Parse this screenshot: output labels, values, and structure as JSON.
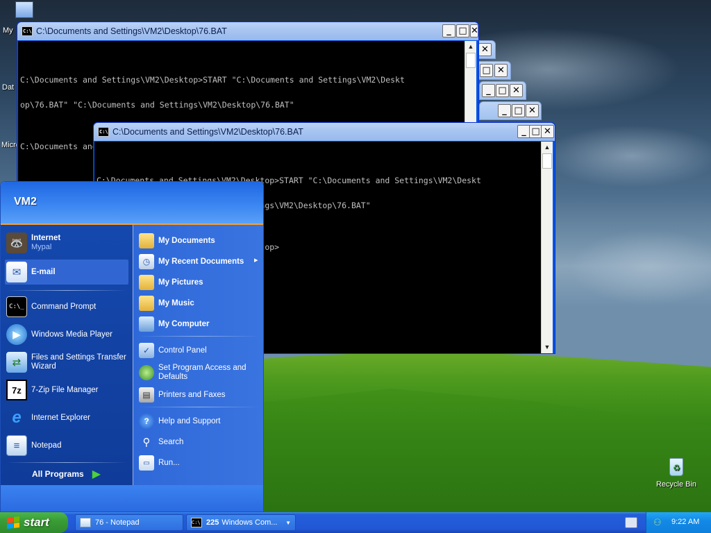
{
  "desktop": {
    "icons": [
      {
        "label": "My"
      },
      {
        "label": "Dat"
      },
      {
        "label": "Micro"
      },
      {
        "label": "Recycle Bin"
      }
    ]
  },
  "windows": {
    "back_window": {
      "title": "C:\\Documents and Settings\\VM2\\Desktop\\76.BAT",
      "lines": [
        "",
        "C:\\Documents and Settings\\VM2\\Desktop>START \"C:\\Documents and Settings\\VM2\\Deskt",
        "op\\76.BAT\" \"C:\\Documents and Settings\\VM2\\Desktop\\76.BAT\"",
        "",
        "C:\\Documents and Settings\\VM2\\Desktop>"
      ]
    },
    "front_window": {
      "title": "C:\\Documents and Settings\\VM2\\Desktop\\76.BAT",
      "lines": [
        "",
        "C:\\Documents and Settings\\VM2\\Desktop>START \"C:\\Documents and Settings\\VM2\\Deskt",
        "op\\76.BAT\" \"C:\\Documents and Settings\\VM2\\Desktop\\76.BAT\"",
        "",
        "C:\\Documents and Settings\\VM2\\Desktop>"
      ]
    },
    "buttons": {
      "minimize": "_",
      "maximize": "□",
      "close": "✕"
    }
  },
  "start_menu": {
    "user_name": "VM2",
    "pinned": [
      {
        "title": "Internet",
        "subtitle": "Mypal",
        "icon": "mypal-raccoon-icon"
      },
      {
        "title": "E-mail",
        "subtitle": "",
        "icon": "email-envelope-icon"
      }
    ],
    "recent": [
      {
        "label": "Command Prompt",
        "icon": "command-prompt-icon"
      },
      {
        "label": "Windows Media Player",
        "icon": "media-player-icon"
      },
      {
        "label": "Files and Settings Transfer Wizard",
        "icon": "transfer-wizard-icon"
      },
      {
        "label": "7-Zip File Manager",
        "icon": "7zip-icon"
      },
      {
        "label": "Internet Explorer",
        "icon": "internet-explorer-icon"
      },
      {
        "label": "Notepad",
        "icon": "notepad-icon"
      }
    ],
    "all_programs": "All Programs",
    "right_items": [
      {
        "label": "My Documents",
        "bold": true,
        "icon": "folder-documents-icon"
      },
      {
        "label": "My Recent Documents",
        "bold": true,
        "icon": "recent-documents-icon",
        "arrow": "▸"
      },
      {
        "label": "My Pictures",
        "bold": true,
        "icon": "folder-pictures-icon"
      },
      {
        "label": "My Music",
        "bold": true,
        "icon": "folder-music-icon"
      },
      {
        "label": "My Computer",
        "bold": true,
        "icon": "computer-icon"
      },
      {
        "label": "Control Panel",
        "bold": false,
        "icon": "control-panel-icon"
      },
      {
        "label": "Set Program Access and Defaults",
        "bold": false,
        "icon": "program-access-icon"
      },
      {
        "label": "Printers and Faxes",
        "bold": false,
        "icon": "printer-icon"
      },
      {
        "label": "Help and Support",
        "bold": false,
        "icon": "help-icon"
      },
      {
        "label": "Search",
        "bold": false,
        "icon": "search-icon"
      },
      {
        "label": "Run...",
        "bold": false,
        "icon": "run-icon"
      }
    ]
  },
  "taskbar": {
    "start_label": "start",
    "buttons": [
      {
        "label": "76 - Notepad",
        "icon": "notepad-icon"
      },
      {
        "label": "225 Windows Com...",
        "count": "225",
        "text": "Windows Com...",
        "icon": "command-prompt-icon"
      }
    ],
    "clock": "9:22 AM"
  },
  "colors": {
    "xp_blue": "#245edb",
    "start_green": "#3a9d36",
    "menu_left": "#0f3c99",
    "menu_right": "#2f69d9"
  }
}
